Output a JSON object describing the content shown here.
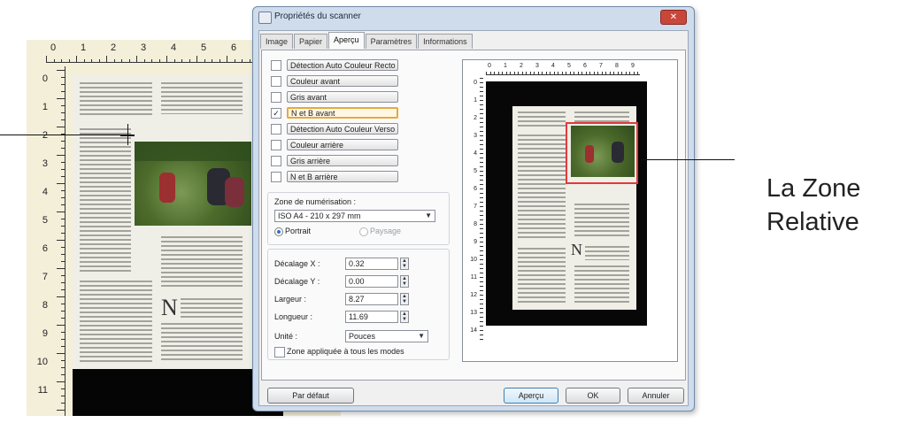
{
  "scan": {
    "ruler_top": [
      "0",
      "1",
      "2",
      "3",
      "4",
      "5",
      "6"
    ],
    "ruler_left": [
      "0",
      "1",
      "2",
      "3",
      "4",
      "5",
      "6",
      "7",
      "8",
      "9",
      "10",
      "11"
    ]
  },
  "dialog": {
    "title": "Propriétés du scanner",
    "close_glyph": "✕",
    "tabs": [
      "Image",
      "Papier",
      "Aperçu",
      "Paramètres",
      "Informations"
    ],
    "active_tab": "Aperçu",
    "options": [
      {
        "label": "Détection Auto Couleur Recto",
        "checked": false
      },
      {
        "label": "Couleur avant",
        "checked": false
      },
      {
        "label": "Gris avant",
        "checked": false
      },
      {
        "label": "N et B avant",
        "checked": true
      },
      {
        "label": "Détection Auto Couleur Verso",
        "checked": false
      },
      {
        "label": "Couleur arrière",
        "checked": false
      },
      {
        "label": "Gris arrière",
        "checked": false
      },
      {
        "label": "N et B arrière",
        "checked": false
      }
    ],
    "zone": {
      "label": "Zone de numérisation :",
      "value": "ISO A4 - 210 x 297 mm",
      "portrait": "Portrait",
      "paysage": "Paysage"
    },
    "fields": {
      "offset_x_label": "Décalage X :",
      "offset_x": "0.32",
      "offset_y_label": "Décalage Y :",
      "offset_y": "0.00",
      "width_label": "Largeur :",
      "width": "8.27",
      "height_label": "Longueur :",
      "height": "11.69",
      "unit_label": "Unité :",
      "unit": "Pouces",
      "apply_all": "Zone appliquée à tous les modes"
    },
    "preview_ruler_top": [
      "0",
      "1",
      "2",
      "3",
      "4",
      "5",
      "6",
      "7",
      "8",
      "9"
    ],
    "preview_ruler_left": [
      "0",
      "1",
      "2",
      "3",
      "4",
      "5",
      "6",
      "7",
      "8",
      "9",
      "10",
      "11",
      "12",
      "13",
      "14"
    ],
    "buttons": {
      "default": "Par défaut",
      "preview": "Aperçu",
      "ok": "OK",
      "cancel": "Annuler"
    }
  },
  "annotation": {
    "line1": "La Zone",
    "line2": "Relative"
  },
  "colors": {
    "frame": "#e23a3a",
    "selected_border": "#e8a93a"
  }
}
